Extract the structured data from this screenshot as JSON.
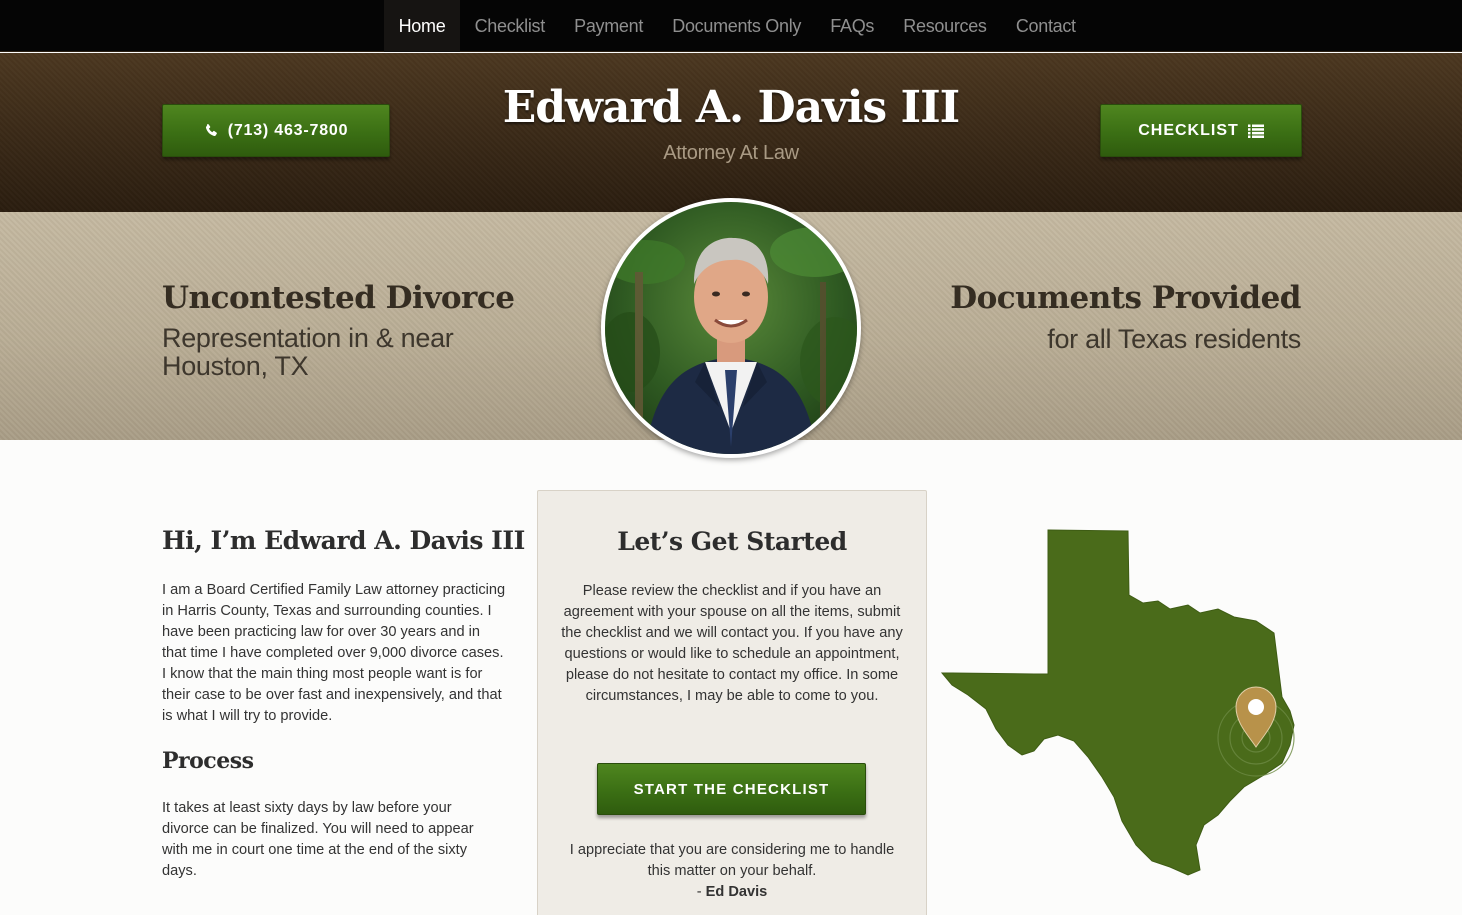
{
  "nav": {
    "items": [
      {
        "label": "Home",
        "active": true
      },
      {
        "label": "Checklist",
        "active": false
      },
      {
        "label": "Payment",
        "active": false
      },
      {
        "label": "Documents Only",
        "active": false
      },
      {
        "label": "FAQs",
        "active": false
      },
      {
        "label": "Resources",
        "active": false
      },
      {
        "label": "Contact",
        "active": false
      }
    ]
  },
  "header": {
    "title": "Edward A. Davis III",
    "subtitle": "Attorney At Law",
    "phone_label": "(713) 463-7800",
    "phone_icon": "phone-icon",
    "checklist_label": "CHECKLIST",
    "checklist_icon": "list-icon"
  },
  "banner": {
    "left_title": "Uncontested Divorce",
    "left_subtitle": "Representation in & near Houston, TX",
    "right_title": "Documents Provided",
    "right_subtitle": "for all Texas residents"
  },
  "about": {
    "title": "Hi, I’m Edward A. Davis III",
    "text": "I am a Board Certified Family Law attorney practicing in Harris County, Texas and surrounding counties. I have been practicing law for over 30 years and in that time I have completed over 9,000 divorce cases. I know that the main thing most people want is for their case to be over fast and inexpensively, and that is what I will try to provide.",
    "process_title": "Process",
    "process_text": "It takes at least sixty days by law before your divorce can be finalized. You will need to appear with me in court one time at the end of the sixty days."
  },
  "get_started": {
    "title": "Let’s Get Started",
    "text": "Please review the checklist and if you have an agreement with your spouse on all the items, submit the checklist and we will contact you. If you have any questions or would like to schedule an appointment, please do not hesitate to contact my office. In some circumstances, I may be able to come to you.",
    "button_label": "START THE CHECKLIST",
    "closing": "I appreciate that you are considering me to handle this matter on your behalf.",
    "signature_prefix": "- ",
    "signature": "Ed Davis"
  },
  "colors": {
    "nav_bg": "#050505",
    "header_brown": "#3c2b18",
    "banner_tan": "#b9ad95",
    "button_green": "#3b6f14",
    "map_green": "#4a6b1a",
    "pin_gold": "#b8924a"
  }
}
